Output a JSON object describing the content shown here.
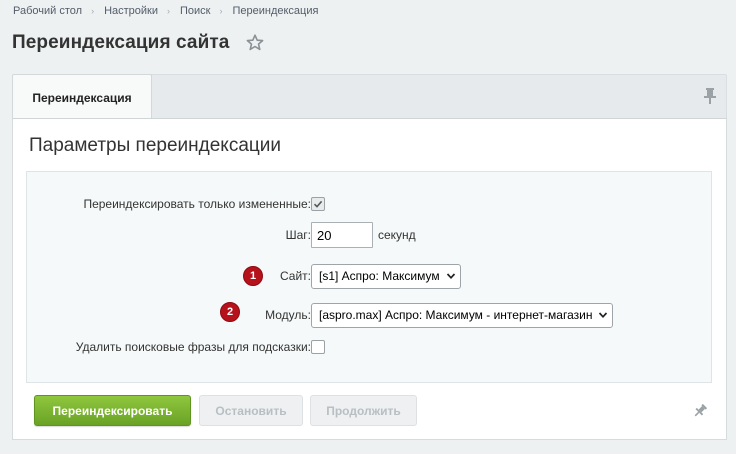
{
  "breadcrumb": {
    "items": [
      {
        "label": "Рабочий стол"
      },
      {
        "label": "Настройки"
      },
      {
        "label": "Поиск"
      },
      {
        "label": "Переиндексация"
      }
    ],
    "separator": "›"
  },
  "page": {
    "title": "Переиндексация сайта",
    "favorite_icon": "star-outline-icon"
  },
  "tabs": {
    "items": [
      {
        "label": "Переиндексация",
        "active": true
      }
    ],
    "pin_icon": "pin-icon"
  },
  "panel": {
    "title": "Параметры переиндексации"
  },
  "form": {
    "changed_only": {
      "label": "Переиндексировать только измененные:",
      "checked": true
    },
    "step": {
      "label": "Шаг:",
      "value": "20",
      "unit": "секунд"
    },
    "site": {
      "label": "Сайт:",
      "selected": "[s1] Аспро: Максимум",
      "badge": "1"
    },
    "module": {
      "label": "Модуль:",
      "selected": "[aspro.max] Аспро: Максимум - интернет-магазин",
      "badge": "2"
    },
    "delete_phrases": {
      "label": "Удалить поисковые фразы для подсказки:",
      "checked": false
    }
  },
  "buttons": {
    "reindex": "Переиндексировать",
    "stop": "Остановить",
    "continue": "Продолжить"
  },
  "colors": {
    "primary_button": "#7ab32e",
    "badge": "#b5121b",
    "background": "#edf1f2"
  }
}
